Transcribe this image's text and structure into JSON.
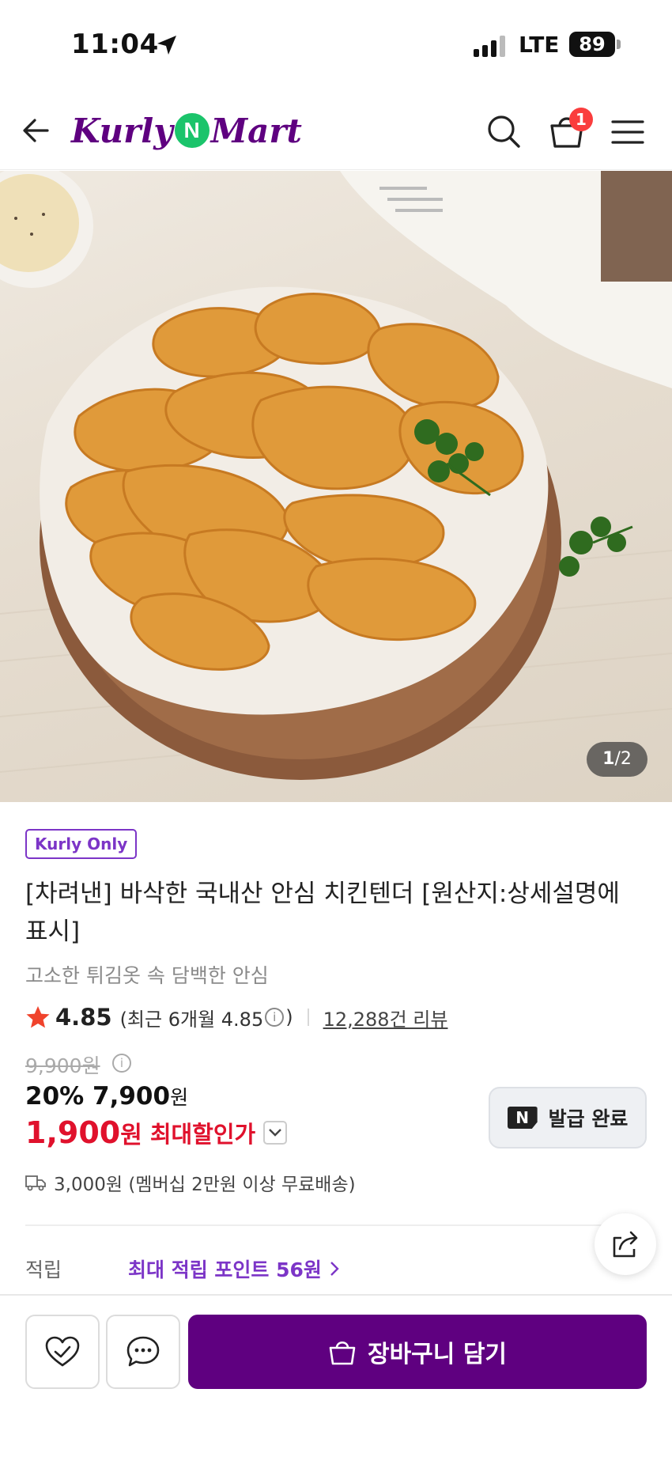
{
  "status_bar": {
    "time": "11:04",
    "network": "LTE",
    "battery": "89"
  },
  "header": {
    "logo_left": "Kurly",
    "logo_n": "N",
    "logo_right": "Mart",
    "cart_count": "1"
  },
  "gallery": {
    "current": "1",
    "separator": "/",
    "total": "2"
  },
  "product": {
    "badge": "Kurly Only",
    "title": "[차려낸] 바삭한 국내산 안심 치킨텐더 [원산지:상세설명에 표시]",
    "subtitle": "고소한 튀김옷 속 담백한 안심",
    "rating": "4.85",
    "rating_recent": "(최근 6개월 4.85",
    "rating_recent_close": ")",
    "reviews": "12,288건 리뷰",
    "original_price": "9,900원",
    "discount_percent": "20%",
    "discount_price": "7,900",
    "discount_unit": "원",
    "max_price": "1,900",
    "max_unit": "원",
    "max_label": "최대할인가",
    "coupon_button": "발급 완료",
    "coupon_logo": "N",
    "delivery": "3,000원 (멤버십 2만원 이상 무료배송)",
    "points_label": "적립",
    "points_value": "최대 적립 포인트 56원"
  },
  "bottom_bar": {
    "add_to_cart": "장바구니 담기"
  },
  "colors": {
    "brand": "#5f0080",
    "accent_purple": "#7c35c7",
    "sale_red": "#e0112c",
    "badge_red": "#fa3d3d",
    "n_green": "#1bc46b"
  }
}
